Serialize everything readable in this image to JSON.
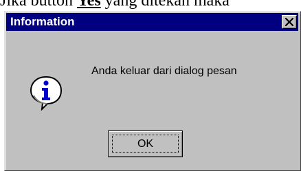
{
  "background_text": {
    "prefix": "Jika button ",
    "underlined": "Yes",
    "suffix": " yang ditekan maka"
  },
  "dialog": {
    "title": "Information",
    "message": "Anda keluar dari dialog pesan",
    "ok_label": "OK",
    "icon": "info-icon",
    "close_icon": "close-icon"
  },
  "colors": {
    "titlebar": "#000080",
    "window_face": "#c0c0c0",
    "title_text": "#ffffff"
  }
}
